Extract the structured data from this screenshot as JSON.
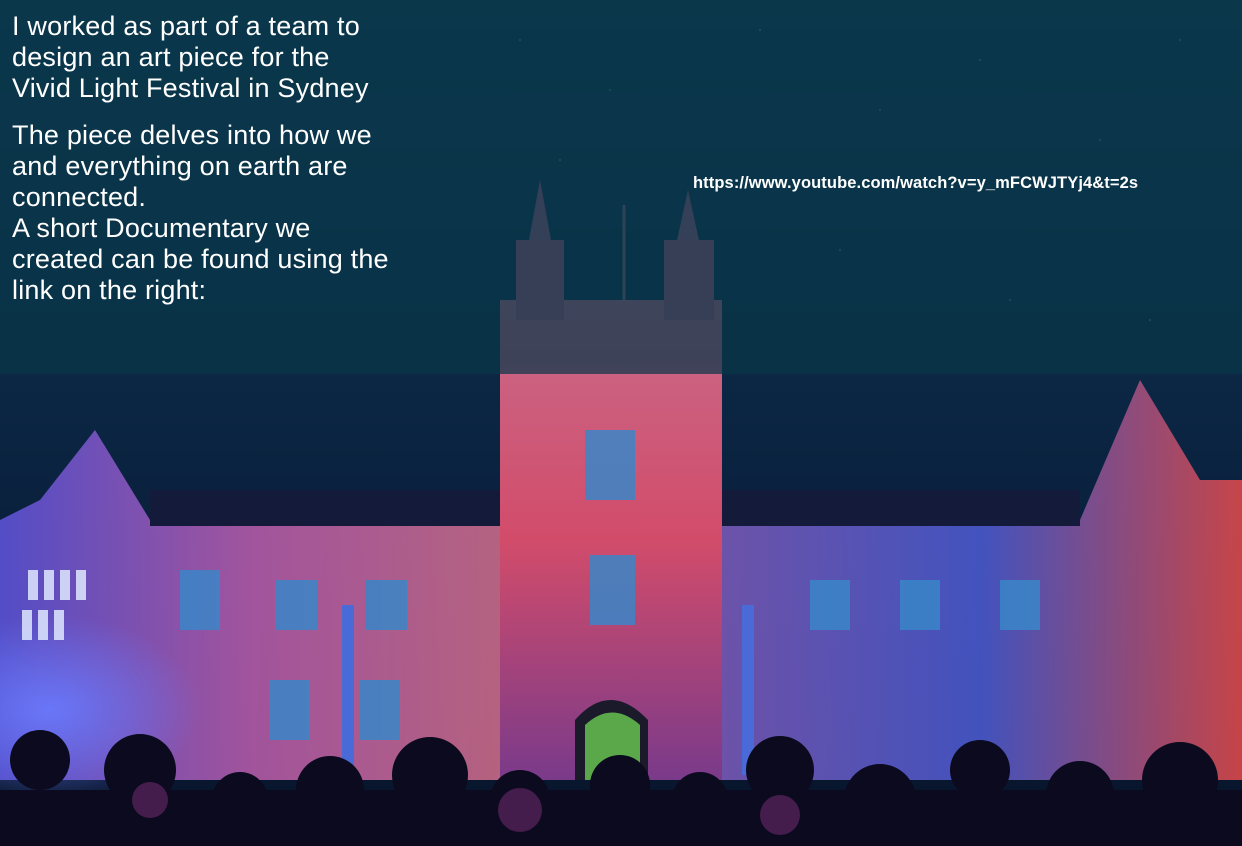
{
  "background": {
    "description_icon": "illuminated-gothic-building-icon",
    "sky_color": "#0b2a44",
    "projection_colors": [
      "#e8507a",
      "#b23cff",
      "#4a6cff",
      "#ff3a3a"
    ]
  },
  "text_panel": {
    "paragraph_1": "I worked as part of a team to\ndesign an art piece for the\nVivid Light Festival in Sydney",
    "paragraph_2": "The piece delves into how we\nand everything on earth are\nconnected.\nA short Documentary we\ncreated can be found using the\nlink on the right:"
  },
  "link": {
    "url_text": "https://www.youtube.com/watch?v=y_mFCWJTYj4&t=2s"
  }
}
